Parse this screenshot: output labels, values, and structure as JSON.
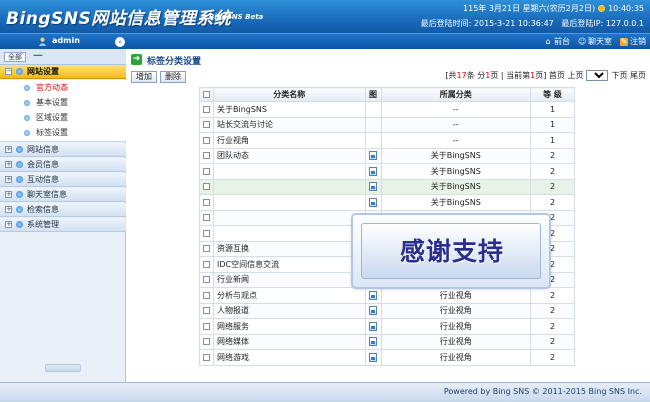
{
  "header": {
    "logo": "BingSNS网站信息管理系统",
    "beta": "BingSNS Beta",
    "date_line": "115年 3月21日 星期六(农历2月2日)",
    "time": "10:40:35",
    "last_login_time_label": "最后登陆时间: ",
    "last_login_time": "2015-3-21 10:36:47",
    "last_login_ip_label": "最后登陆IP: ",
    "last_login_ip": "127.0.0.1"
  },
  "topbar": {
    "username": "admin",
    "collapse_icon": "chevron-left-icon",
    "links": [
      {
        "label": "前台",
        "icon": "home-icon"
      },
      {
        "label": "聊天室",
        "icon": "chat-icon"
      },
      {
        "label": "注销",
        "icon": "logout-icon"
      }
    ]
  },
  "sidebar": {
    "tab_all": "全部",
    "tab_minus": "—",
    "sections": [
      {
        "label": "网站设置",
        "expanded": true,
        "active": true
      },
      {
        "label": "网站信息"
      },
      {
        "label": "会员信息"
      },
      {
        "label": "互动信息"
      },
      {
        "label": "聊天室信息"
      },
      {
        "label": "检索信息"
      },
      {
        "label": "系统管理"
      }
    ],
    "subitems": [
      {
        "label": "官方动态",
        "current": true
      },
      {
        "label": "基本设置"
      },
      {
        "label": "区域设置"
      },
      {
        "label": "标签设置"
      }
    ]
  },
  "main": {
    "title": "标签分类设置",
    "add_button": "增加",
    "delete_button": "删除",
    "pager": {
      "p1": "[共 ",
      "total": "17",
      "p2": " 条 分 ",
      "pages": "1",
      "p3": " 页 | 当前第 ",
      "current": "1",
      "p4": " 页] 首页 上页",
      "selected_page": "1",
      "p5": "下页 尾页"
    },
    "table": {
      "headers": [
        "",
        "分类名称",
        "图",
        "所属分类",
        "等 级"
      ],
      "rows": [
        {
          "name": "关于BingSNS",
          "pic": false,
          "parent": "--",
          "level": "1"
        },
        {
          "name": "站长交流与讨论",
          "pic": false,
          "parent": "--",
          "level": "1"
        },
        {
          "name": "行业视角",
          "pic": false,
          "parent": "--",
          "level": "1"
        },
        {
          "name": "团队动态",
          "pic": true,
          "parent": "关于BingSNS",
          "level": "2"
        },
        {
          "name": "",
          "pic": true,
          "parent": "关于BingSNS",
          "level": "2"
        },
        {
          "name": "",
          "pic": true,
          "parent": "关于BingSNS",
          "level": "2",
          "hl": true
        },
        {
          "name": "",
          "pic": true,
          "parent": "关于BingSNS",
          "level": "2"
        },
        {
          "name": "",
          "pic": true,
          "parent": "关于BingSNS",
          "level": "2"
        },
        {
          "name": "",
          "pic": true,
          "parent": "站长交流与讨论",
          "level": "2"
        },
        {
          "name": "资源互换",
          "pic": true,
          "parent": "站长交流与讨论",
          "level": "2"
        },
        {
          "name": "IDC空间信息交流",
          "pic": true,
          "parent": "站长交流与讨论",
          "level": "2"
        },
        {
          "name": "行业新闻",
          "pic": true,
          "parent": "行业视角",
          "level": "2"
        },
        {
          "name": "分析与观点",
          "pic": true,
          "parent": "行业视角",
          "level": "2"
        },
        {
          "name": "人物报道",
          "pic": true,
          "parent": "行业视角",
          "level": "2"
        },
        {
          "name": "网络服务",
          "pic": true,
          "parent": "行业视角",
          "level": "2"
        },
        {
          "name": "网络媒体",
          "pic": true,
          "parent": "行业视角",
          "level": "2"
        },
        {
          "name": "网络游戏",
          "pic": true,
          "parent": "行业视角",
          "level": "2"
        }
      ]
    }
  },
  "overlay": {
    "text": "感谢支持"
  },
  "footer": {
    "text": "Powered by Bing SNS © 2011-2015 Bing SNS Inc."
  }
}
